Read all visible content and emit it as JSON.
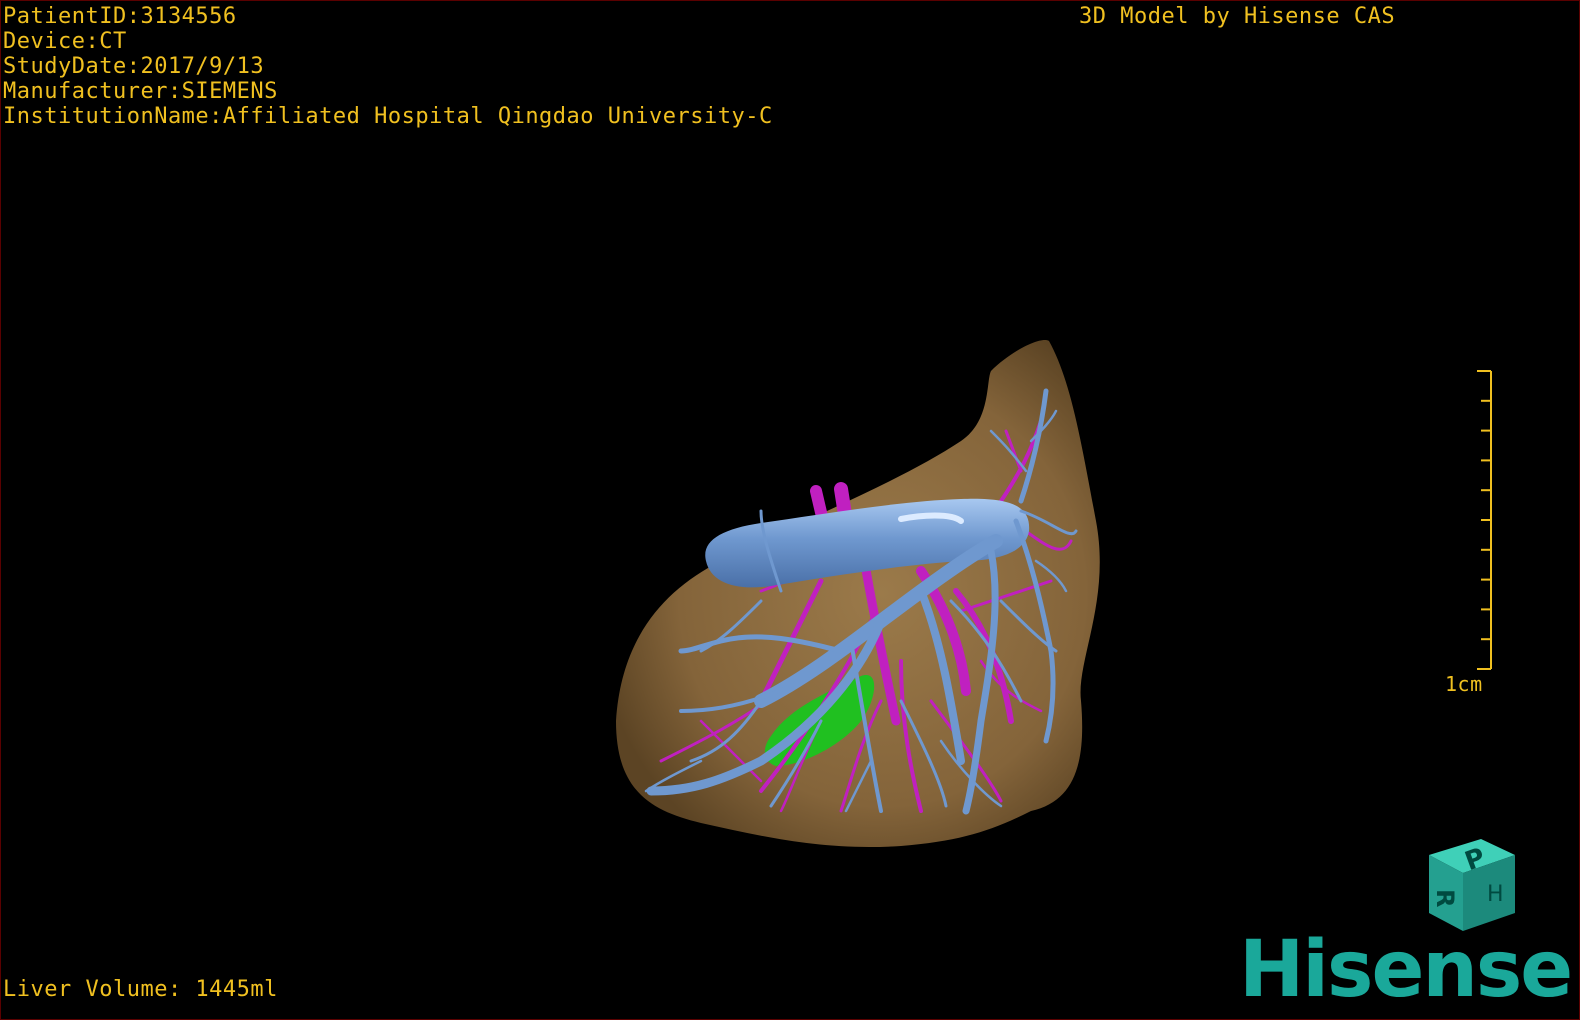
{
  "overlay": {
    "patient_id": "PatientID:3134556",
    "device": "Device:CT",
    "study_date": "StudyDate:2017/9/13",
    "manufacturer": "Manufacturer:SIEMENS",
    "institution": "InstitutionName:Affiliated Hospital Qingdao University-C",
    "brand_caption": "3D Model by Hisense CAS",
    "liver_volume": "Liver Volume: 1445ml"
  },
  "scale": {
    "label": "1cm",
    "ticks": 10
  },
  "orientation_cube": {
    "labels": [
      "P",
      "H",
      "R"
    ]
  },
  "logo": {
    "text": "Hisense"
  },
  "colors": {
    "overlay_text": "#f0c020",
    "liver": "#8b6a3e",
    "portal_vein": "#6f98cf",
    "hepatic_artery": "#c020c0",
    "gallbladder": "#20c020",
    "logo": "#1aa89a"
  }
}
